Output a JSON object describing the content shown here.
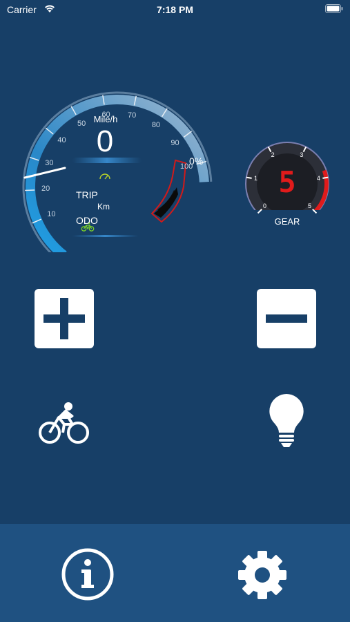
{
  "status_bar": {
    "carrier": "Carrier",
    "time": "7:18 PM"
  },
  "speedometer": {
    "unit": "Mile/h",
    "speed": "0",
    "max_speed": 100,
    "tick_labels": [
      "10",
      "20",
      "30",
      "40",
      "50",
      "60",
      "70",
      "80",
      "90",
      "100"
    ],
    "battery_percent": "0%",
    "trip_label": "TRIP",
    "distance_unit": "Km",
    "odo_label": "ODO"
  },
  "gear": {
    "value": "5",
    "label": "GEAR",
    "tick_labels": [
      "0",
      "1",
      "2",
      "3",
      "4",
      "5"
    ]
  },
  "colors": {
    "background": "#173f67",
    "bottom_bar": "#1f5181",
    "gauge_accent": "#1ea0e6",
    "gear_digit": "#e01b1b",
    "eco_green": "#7bd12a"
  },
  "controls": {
    "plus_icon": "plus-icon",
    "minus_icon": "minus-icon",
    "bike_icon": "bicycle-icon",
    "bulb_icon": "lightbulb-icon"
  },
  "bottom_bar": {
    "info_icon": "info-icon",
    "settings_icon": "gear-icon"
  }
}
